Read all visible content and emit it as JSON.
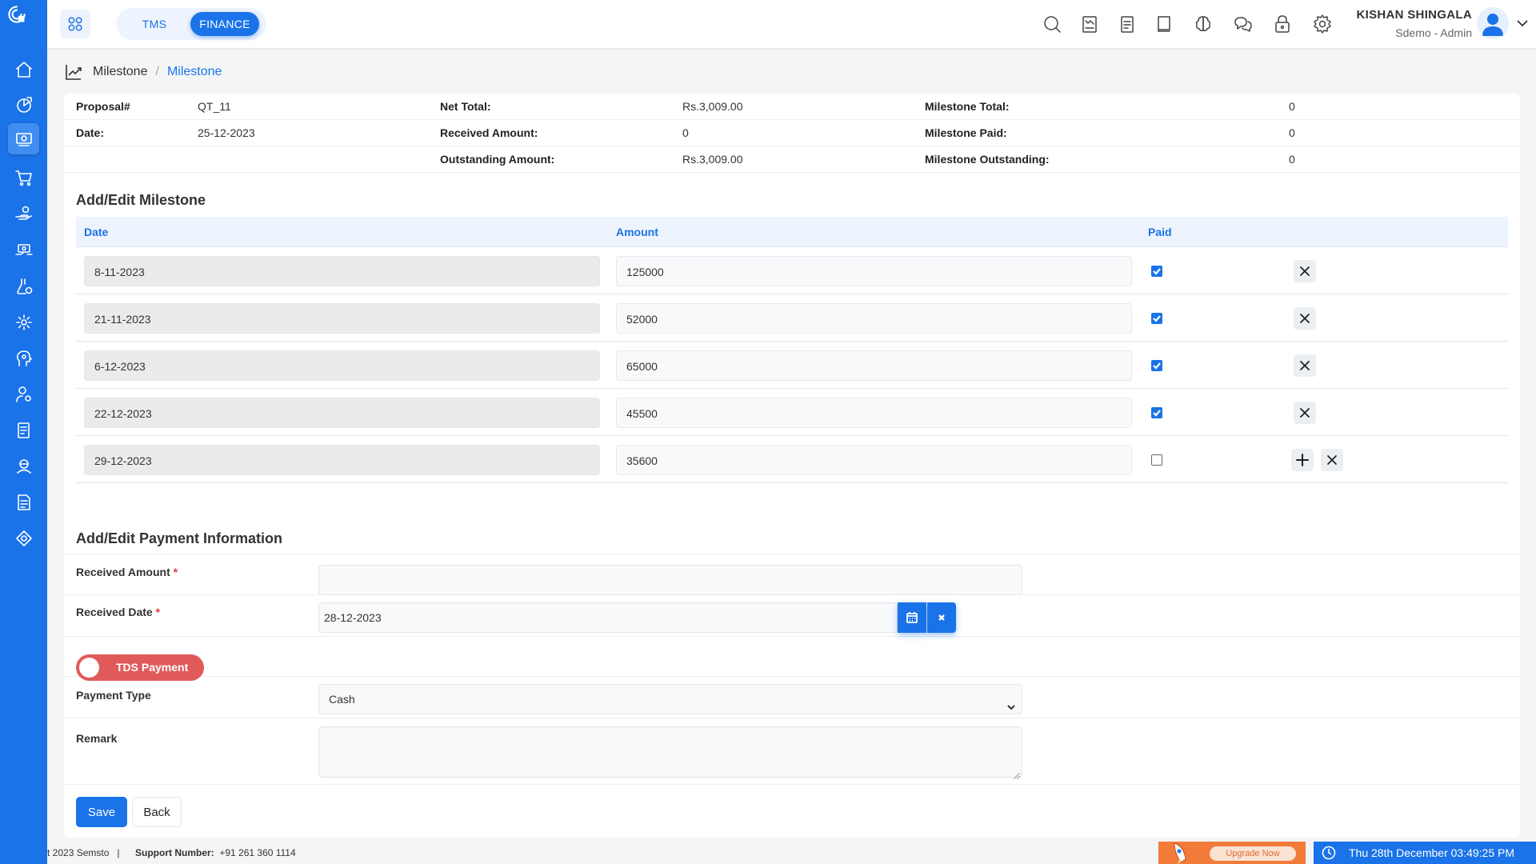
{
  "topbar": {
    "modules": [
      "TMS",
      "FINANCE"
    ],
    "active_module": "FINANCE",
    "user_name": "KISHAN SHINGALA",
    "user_role": "Sdemo - Admin"
  },
  "sidebar": {
    "icons": [
      "home-icon",
      "reports-icon",
      "finance-icon",
      "cart-icon",
      "hand-coin-icon",
      "money-transfer-icon",
      "flask-icon",
      "settings-gear-icon",
      "profile-help-icon",
      "user-settings-icon",
      "document-icon",
      "support-icon",
      "invoice-icon",
      "tools-icon"
    ],
    "active_index": 2
  },
  "breadcrumb": {
    "parent": "Milestone",
    "separator": "/",
    "current": "Milestone"
  },
  "summary": {
    "rows": [
      [
        {
          "label": "Proposal#",
          "value": "QT_11"
        },
        {
          "label": "Net Total:",
          "value": "Rs.3,009.00"
        },
        {
          "label": "Milestone Total:",
          "value": "0"
        }
      ],
      [
        {
          "label": "Date:",
          "value": "25-12-2023"
        },
        {
          "label": "Received Amount:",
          "value": "0"
        },
        {
          "label": "Milestone Paid:",
          "value": "0"
        }
      ],
      [
        {
          "label": "",
          "value": ""
        },
        {
          "label": "Outstanding Amount:",
          "value": "Rs.3,009.00"
        },
        {
          "label": "Milestone Outstanding:",
          "value": "0"
        }
      ]
    ]
  },
  "milestone": {
    "title": "Add/Edit Milestone",
    "columns": [
      "Date",
      "Amount",
      "Paid"
    ],
    "rows": [
      {
        "date": "8-11-2023",
        "amount": "125000",
        "paid": true
      },
      {
        "date": "21-11-2023",
        "amount": "52000",
        "paid": true
      },
      {
        "date": "6-12-2023",
        "amount": "65000",
        "paid": true
      },
      {
        "date": "22-12-2023",
        "amount": "45500",
        "paid": true
      },
      {
        "date": "29-12-2023",
        "amount": "35600",
        "paid": false
      }
    ]
  },
  "payment": {
    "title": "Add/Edit Payment Information",
    "received_amount_label": "Received Amount",
    "received_amount_value": "",
    "received_date_label": "Received Date",
    "received_date_value": "28-12-2023",
    "required_mark": "*",
    "tds_label": "TDS Payment",
    "payment_type_label": "Payment Type",
    "payment_type_value": "Cash",
    "remark_label": "Remark",
    "remark_value": ""
  },
  "actions": {
    "save": "Save",
    "back": "Back"
  },
  "footer": {
    "copyright": "t 2023 Semsto",
    "separator": "|",
    "support_label": "Support Number:",
    "support_number": "+91 261 360 1114",
    "upgrade_label": "Upgrade Now",
    "datetime": "Thu 28th December 03:49:25 PM"
  },
  "colors": {
    "primary": "#1a73e8",
    "danger": "#e05a5a",
    "upgrade": "#f27b3a"
  }
}
